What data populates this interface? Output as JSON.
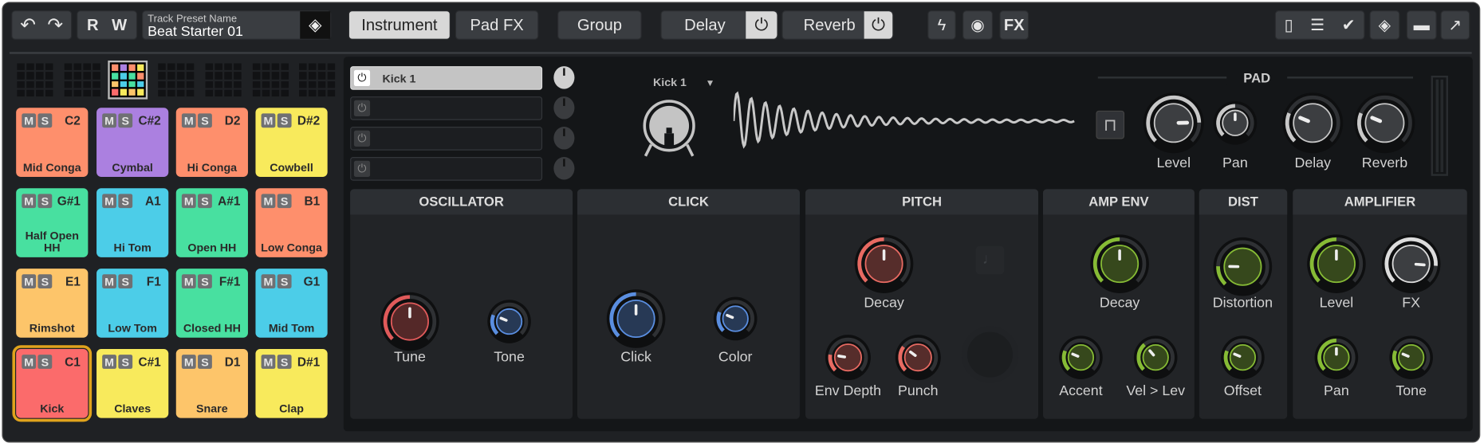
{
  "toolbar": {
    "read": "R",
    "write": "W",
    "preset_label": "Track Preset Name",
    "preset_value": "Beat Starter 01",
    "tabs": [
      "Instrument",
      "Pad FX"
    ],
    "active_tab": "Instrument",
    "group": "Group",
    "delay": "Delay",
    "reverb": "Reverb",
    "fx": "FX",
    "icons": [
      "undo-icon",
      "redo-icon",
      "preset-browser-icon",
      "lightning-icon",
      "midi-icon",
      "fit-width-icon",
      "fit-list-icon",
      "check-icon",
      "preset-icon",
      "folder-icon",
      "export-icon"
    ]
  },
  "kits": {
    "count": 8,
    "selected": 2
  },
  "pads": [
    {
      "name": "Mid Conga",
      "note": "C2",
      "color": "#fe8f6c"
    },
    {
      "name": "Cymbal",
      "note": "C#2",
      "color": "#ab80e0"
    },
    {
      "name": "Hi Conga",
      "note": "D2",
      "color": "#fe8f6c"
    },
    {
      "name": "Cowbell",
      "note": "D#2",
      "color": "#f8ea5c"
    },
    {
      "name": "Half Open HH",
      "note": "G#1",
      "color": "#48e0a0"
    },
    {
      "name": "Hi Tom",
      "note": "A1",
      "color": "#4ccde8"
    },
    {
      "name": "Open HH",
      "note": "A#1",
      "color": "#48e0a0"
    },
    {
      "name": "Low Conga",
      "note": "B1",
      "color": "#fe8f6c"
    },
    {
      "name": "Rimshot",
      "note": "E1",
      "color": "#fdc56a"
    },
    {
      "name": "Low Tom",
      "note": "F1",
      "color": "#4ccde8"
    },
    {
      "name": "Closed HH",
      "note": "F#1",
      "color": "#48e0a0"
    },
    {
      "name": "Mid Tom",
      "note": "G1",
      "color": "#4ccde8"
    },
    {
      "name": "Kick",
      "note": "C1",
      "color": "#fb6b6b",
      "selected": true
    },
    {
      "name": "Claves",
      "note": "C#1",
      "color": "#f8ea5c"
    },
    {
      "name": "Snare",
      "note": "D1",
      "color": "#fdc56a"
    },
    {
      "name": "Clap",
      "note": "D#1",
      "color": "#f8ea5c"
    }
  ],
  "pad_labels": {
    "mute": "M",
    "solo": "S"
  },
  "layers": [
    {
      "name": "Kick 1",
      "on": true
    },
    {
      "name": "",
      "on": false
    },
    {
      "name": "",
      "on": false
    },
    {
      "name": "",
      "on": false
    }
  ],
  "instrument": {
    "selected": "Kick 1"
  },
  "pad_section": {
    "title": "PAD",
    "knobs": [
      {
        "label": "Level",
        "value": 0.83,
        "color": "#c8c8c8"
      },
      {
        "label": "Pan",
        "value": 0.5,
        "color": "#c8c8c8"
      },
      {
        "label": "Delay",
        "value": 0.25,
        "color": "#c8c8c8"
      },
      {
        "label": "Reverb",
        "value": 0.25,
        "color": "#c8c8c8"
      }
    ]
  },
  "sections": [
    {
      "title": "OSCILLATOR",
      "knobs": [
        {
          "label": "Tune",
          "value": 0.5,
          "color": "#e05a5a"
        },
        {
          "label": "Tone",
          "value": 0.25,
          "color": "#5a8ee0"
        }
      ]
    },
    {
      "title": "CLICK",
      "knobs": [
        {
          "label": "Click",
          "value": 0.5,
          "color": "#5a8ee0"
        },
        {
          "label": "Color",
          "value": 0.25,
          "color": "#5a8ee0"
        }
      ]
    },
    {
      "title": "PITCH",
      "knobs": [
        {
          "label": "Decay",
          "value": 0.5,
          "color": "#e86a62"
        },
        {
          "label": "Env Depth",
          "value": 0.2,
          "color": "#e86a62"
        },
        {
          "label": "Punch",
          "value": 0.3,
          "color": "#e86a62"
        }
      ]
    },
    {
      "title": "AMP ENV",
      "knobs": [
        {
          "label": "Decay",
          "value": 0.5,
          "color": "#86bb35"
        },
        {
          "label": "Accent",
          "value": 0.25,
          "color": "#86bb35"
        },
        {
          "label": "Vel > Lev",
          "value": 0.35,
          "color": "#86bb35"
        }
      ]
    },
    {
      "title": "DIST",
      "knobs": [
        {
          "label": "Distortion",
          "value": 0.17,
          "color": "#86bb35"
        },
        {
          "label": "Offset",
          "value": 0.25,
          "color": "#86bb35"
        }
      ]
    },
    {
      "title": "AMPLIFIER",
      "knobs": [
        {
          "label": "Level",
          "value": 0.5,
          "color": "#86bb35"
        },
        {
          "label": "FX",
          "value": 0.85,
          "color": "#dcdcdc"
        },
        {
          "label": "Pan",
          "value": 0.5,
          "color": "#86bb35"
        },
        {
          "label": "Tone",
          "value": 0.25,
          "color": "#86bb35"
        }
      ]
    }
  ]
}
